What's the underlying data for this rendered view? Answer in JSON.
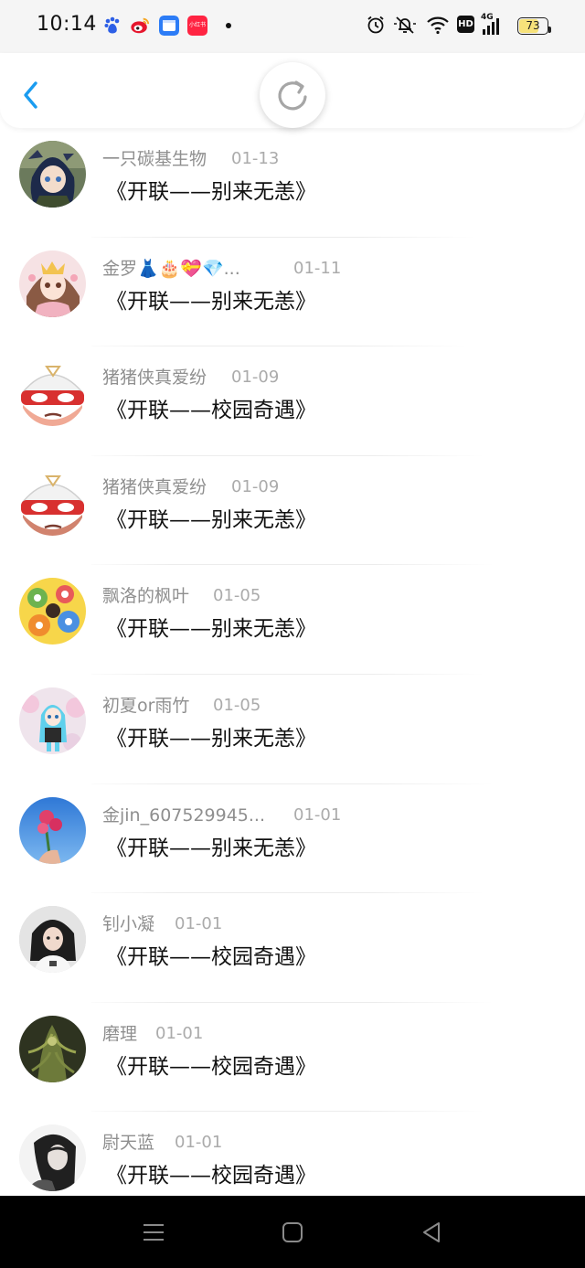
{
  "status_bar": {
    "time": "10:14",
    "battery": "73",
    "battery_level": 0.73,
    "hd_label": "HD",
    "network_label": "4G",
    "notification_icons": [
      "baidu-icon",
      "weibo-icon",
      "files-app-icon",
      "xiaohongshu-icon",
      "dot-icon"
    ],
    "xhs_label": "小红书"
  },
  "colors": {
    "accent": "#1a9cf0",
    "name_gray": "#8f8f8f",
    "date_gray": "#ababab",
    "title_black": "#111111"
  },
  "header": {
    "back_icon": "chevron-left-icon",
    "refresh_icon": "refresh-icon"
  },
  "comments": [
    {
      "name": "一只碳基生物",
      "date": "01-13",
      "title": "《开联——别来无恙》"
    },
    {
      "name": "金罗👗🎂💝💎...",
      "date": "01-11",
      "title": "《开联——别来无恙》"
    },
    {
      "name": "猪猪侠真爱纷",
      "date": "01-09",
      "title": "《开联——校园奇遇》"
    },
    {
      "name": "猪猪侠真爱纷",
      "date": "01-09",
      "title": "《开联——别来无恙》"
    },
    {
      "name": "飘洛的枫叶",
      "date": "01-05",
      "title": "《开联——别来无恙》"
    },
    {
      "name": "初夏or雨竹",
      "date": "01-05",
      "title": "《开联——别来无恙》"
    },
    {
      "name": "金jin_607529945...",
      "date": "01-01",
      "title": "《开联——别来无恙》"
    },
    {
      "name": "钊小凝",
      "date": "01-01",
      "title": "《开联——校园奇遇》"
    },
    {
      "name": "磨理",
      "date": "01-01",
      "title": "《开联——校园奇遇》"
    },
    {
      "name": "尉天蓝",
      "date": "01-01",
      "title": "《开联——校园奇遇》"
    }
  ],
  "nav_bar": {
    "icons": [
      "menu-icon",
      "home-square-icon",
      "back-triangle-icon"
    ]
  }
}
